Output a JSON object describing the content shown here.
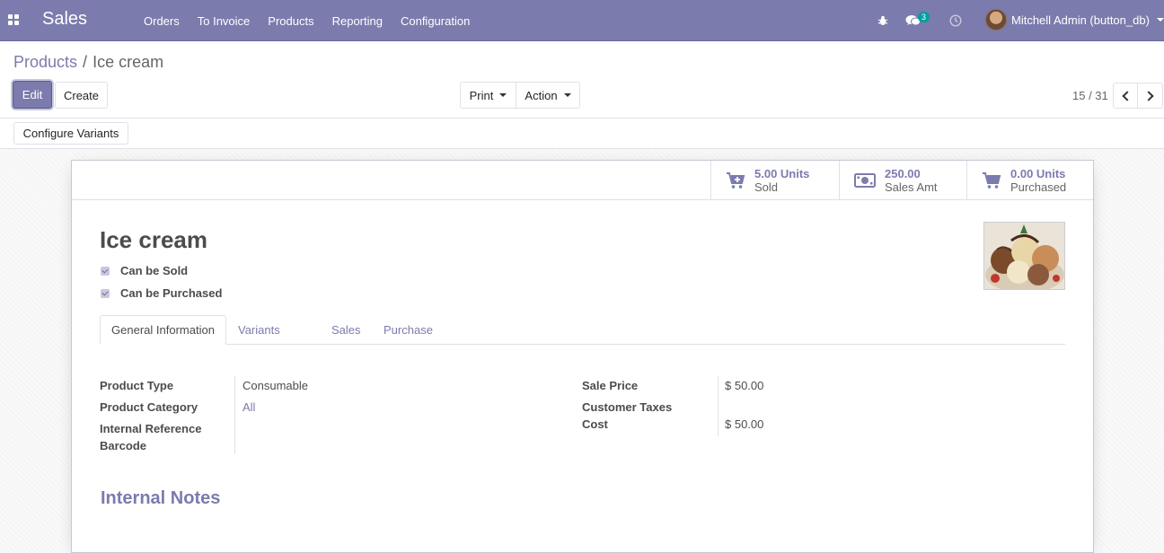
{
  "navbar": {
    "app_name": "Sales",
    "menu": [
      "Orders",
      "To Invoice",
      "Products",
      "Reporting",
      "Configuration"
    ],
    "message_count": "3",
    "user_name": "Mitchell Admin (button_db)"
  },
  "breadcrumb": {
    "parent": "Products",
    "current": "Ice cream"
  },
  "control_panel": {
    "edit_label": "Edit",
    "create_label": "Create",
    "print_label": "Print",
    "action_label": "Action",
    "pager": "15 / 31"
  },
  "statusbar": {
    "configure_variants_label": "Configure Variants"
  },
  "smart_buttons": [
    {
      "value": "5.00 Units",
      "label": "Sold",
      "icon": "cart-plus-icon"
    },
    {
      "value": "250.00",
      "label": "Sales Amt",
      "icon": "money-icon"
    },
    {
      "value": "0.00 Units",
      "label": "Purchased",
      "icon": "shopping-cart-icon"
    }
  ],
  "product": {
    "name": "Ice cream",
    "can_be_sold_label": "Can be Sold",
    "can_be_purchased_label": "Can be Purchased",
    "can_be_sold": true,
    "can_be_purchased": true
  },
  "tabs": [
    "General Information",
    "Variants",
    "Sales",
    "Purchase"
  ],
  "general_info": {
    "left": [
      {
        "label": "Product Type",
        "value": "Consumable"
      },
      {
        "label": "Product Category",
        "value": "All"
      },
      {
        "label": "Internal Reference",
        "value": ""
      },
      {
        "label": "Barcode",
        "value": ""
      }
    ],
    "right": [
      {
        "label": "Sale Price",
        "value": "$ 50.00"
      },
      {
        "label": "Customer Taxes",
        "value": ""
      },
      {
        "label": "Cost",
        "value": "$ 50.00"
      }
    ]
  },
  "internal_notes_title": "Internal Notes",
  "colors": {
    "brand": "#7c7bad",
    "badge": "#00a09d"
  }
}
